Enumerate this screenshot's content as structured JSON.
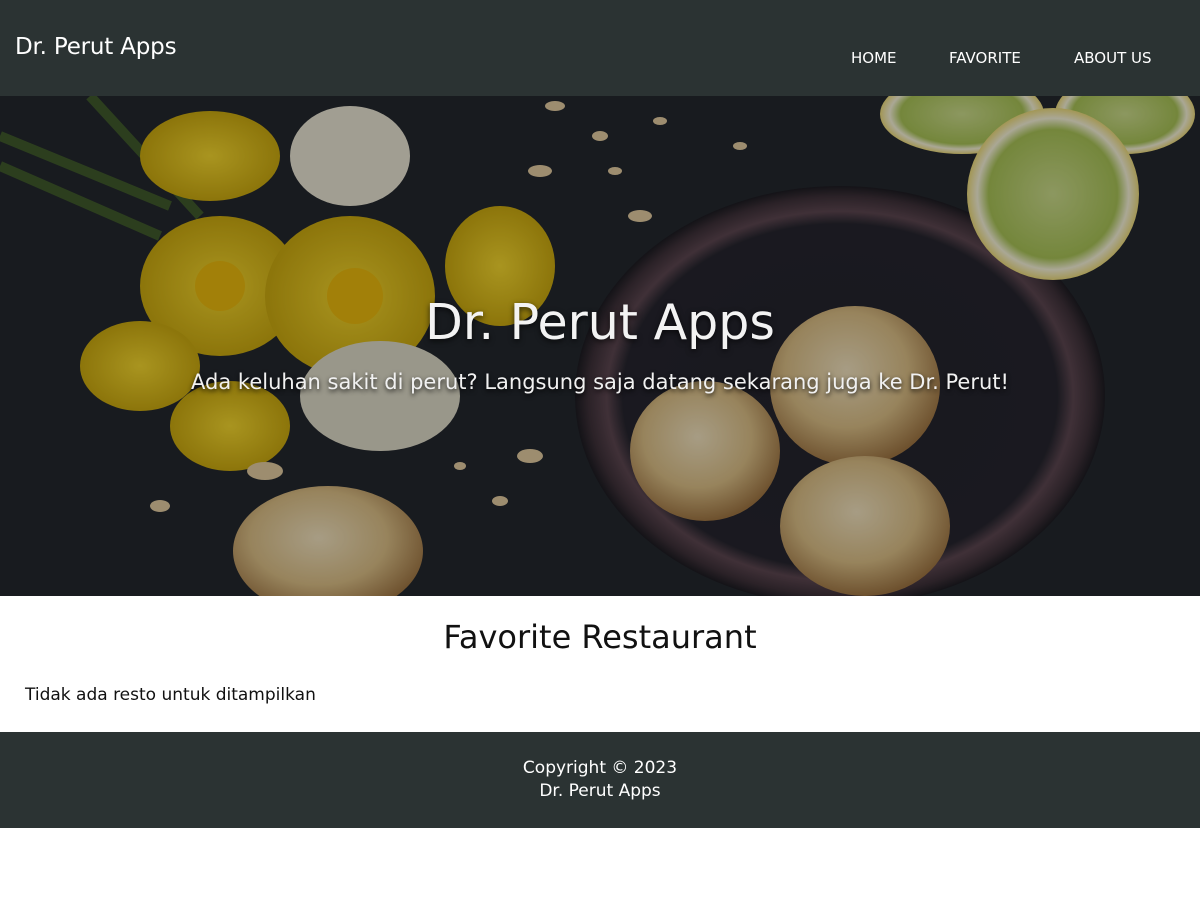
{
  "app_bar": {
    "brand": "Dr. Perut Apps",
    "nav": [
      {
        "label": "HOME"
      },
      {
        "label": "FAVORITE"
      },
      {
        "label": "ABOUT US"
      }
    ]
  },
  "hero": {
    "title": "Dr. Perut Apps",
    "subtitle": "Ada keluhan sakit di perut? Langsung saja datang sekarang juga ke Dr. Perut!",
    "image_icon": "food-photo-daffodils-cookies-lemons"
  },
  "main": {
    "title": "Favorite Restaurant",
    "empty_message": "Tidak ada resto untuk ditampilkan"
  },
  "footer": {
    "line1": "Copyright © 2023",
    "line2": "Dr. Perut Apps"
  },
  "colors": {
    "bar_background": "#2b3333",
    "bar_text": "#ffffff",
    "content_background": "#ffffff"
  }
}
